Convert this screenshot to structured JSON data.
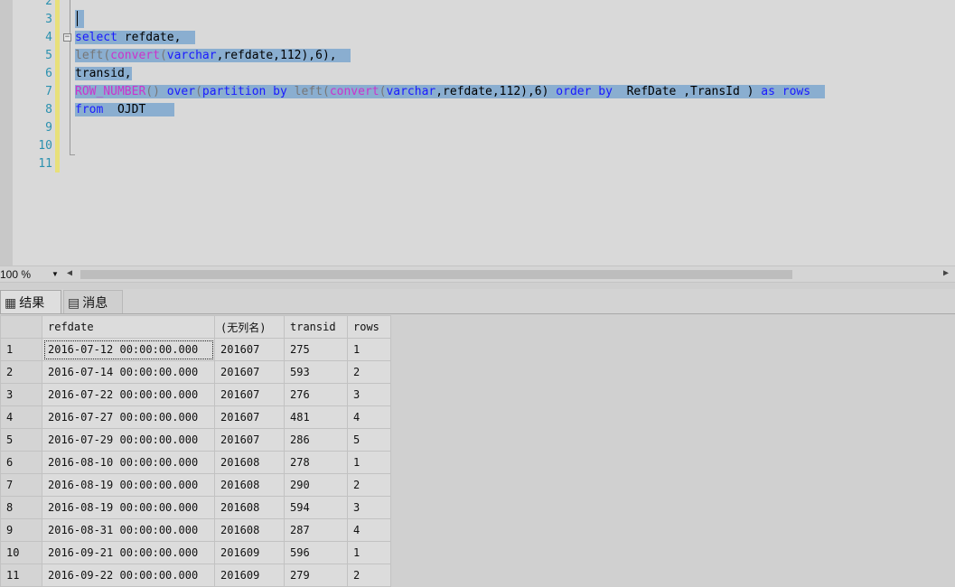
{
  "editor": {
    "line_numbers": [
      "2",
      "3",
      "4",
      "5",
      "6",
      "7",
      "8",
      "9",
      "10",
      "11"
    ],
    "lines": {
      "l4": [
        "select",
        " refdate,"
      ],
      "l5": [
        "left",
        "(",
        "convert",
        "(",
        "varchar",
        ",refdate,112),6),"
      ],
      "l6": [
        "transid,"
      ],
      "l7": [
        "ROW_NUMBER",
        "()",
        " over",
        "(",
        "partition",
        " by",
        " left",
        "(",
        "convert",
        "(",
        "varchar",
        ",refdate,112),6)",
        " order",
        " by",
        "  RefDate ,TransId )",
        " as",
        " rows"
      ],
      "l8": [
        "from",
        "  OJDT"
      ]
    }
  },
  "zoom": {
    "value": "100 %"
  },
  "tabs": {
    "results": "结果",
    "messages": "消息"
  },
  "grid": {
    "columns": [
      "refdate",
      "(无列名)",
      "transid",
      "rows"
    ],
    "rows": [
      [
        "1",
        "2016-07-12 00:00:00.000",
        "201607",
        "275",
        "1"
      ],
      [
        "2",
        "2016-07-14 00:00:00.000",
        "201607",
        "593",
        "2"
      ],
      [
        "3",
        "2016-07-22 00:00:00.000",
        "201607",
        "276",
        "3"
      ],
      [
        "4",
        "2016-07-27 00:00:00.000",
        "201607",
        "481",
        "4"
      ],
      [
        "5",
        "2016-07-29 00:00:00.000",
        "201607",
        "286",
        "5"
      ],
      [
        "6",
        "2016-08-10 00:00:00.000",
        "201608",
        "278",
        "1"
      ],
      [
        "7",
        "2016-08-19 00:00:00.000",
        "201608",
        "290",
        "2"
      ],
      [
        "8",
        "2016-08-19 00:00:00.000",
        "201608",
        "594",
        "3"
      ],
      [
        "9",
        "2016-08-31 00:00:00.000",
        "201608",
        "287",
        "4"
      ],
      [
        "10",
        "2016-09-21 00:00:00.000",
        "201609",
        "596",
        "1"
      ],
      [
        "11",
        "2016-09-22 00:00:00.000",
        "201609",
        "279",
        "2"
      ]
    ]
  }
}
